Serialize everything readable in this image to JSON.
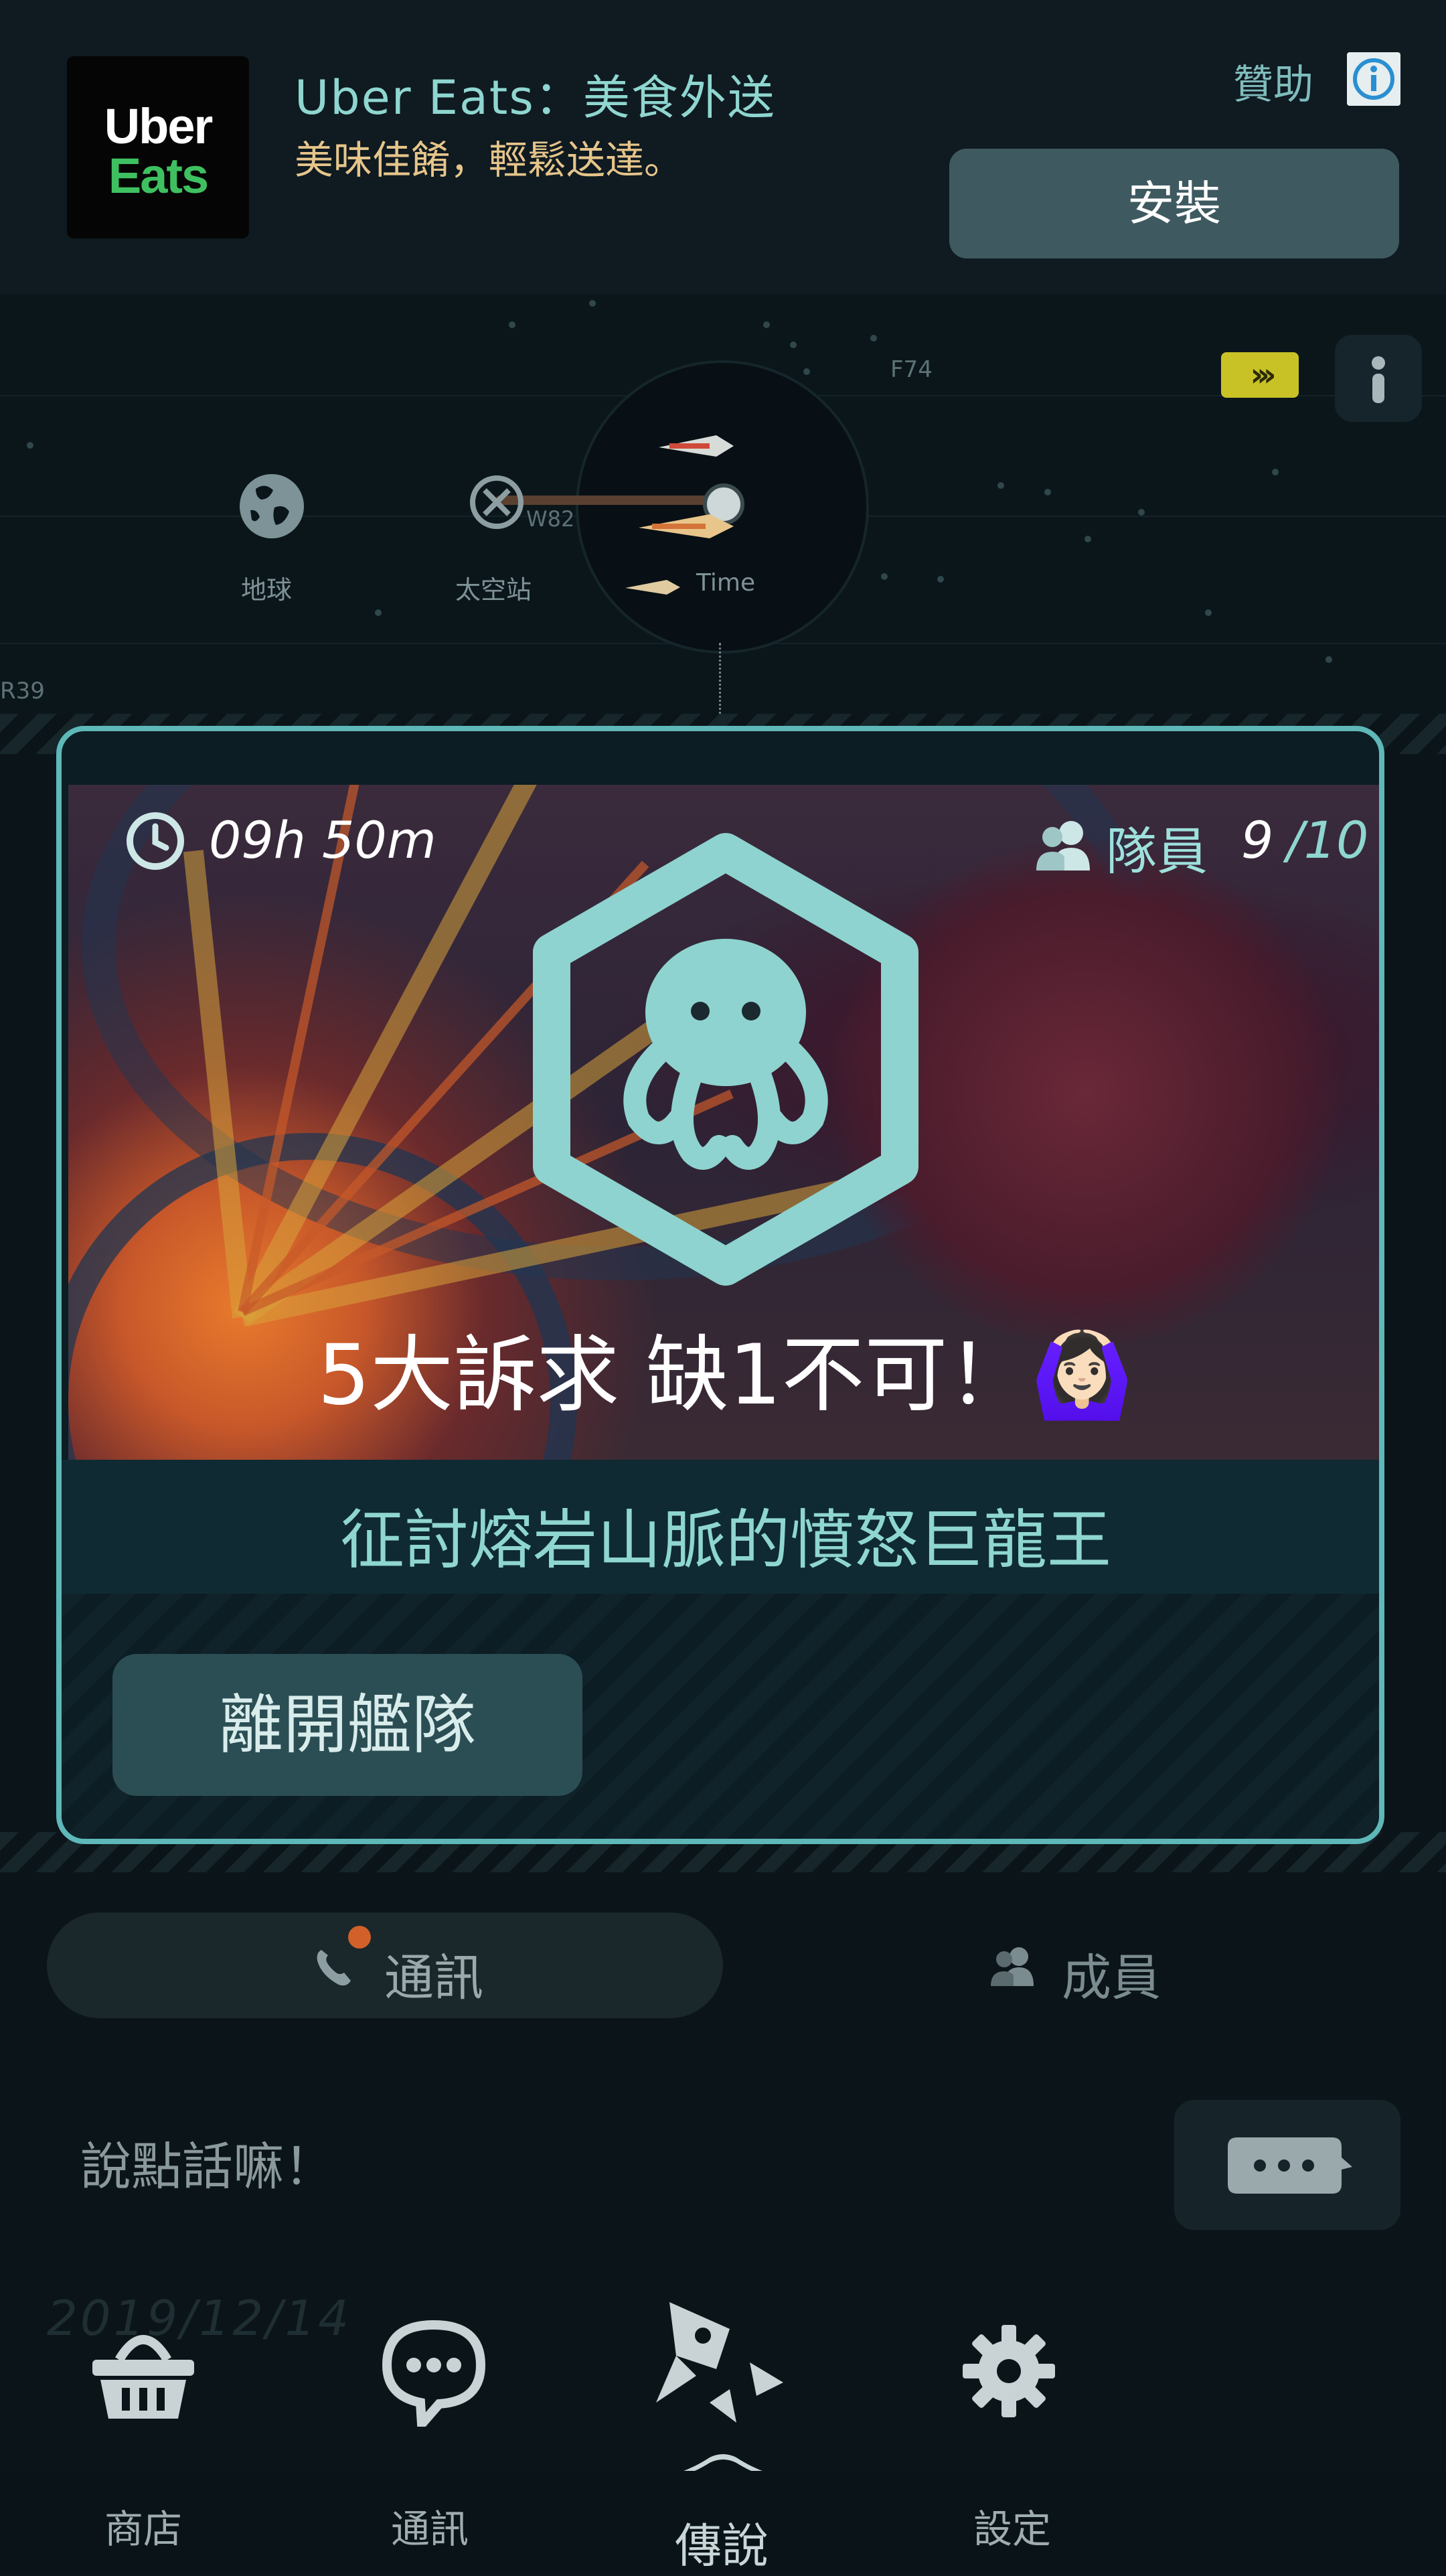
{
  "ad": {
    "logo_line1": "Uber",
    "logo_line2": "Eats",
    "title": "Uber Eats：美食外送",
    "subtitle": "美味佳餚，輕鬆送達。",
    "sponsor_label": "贊助",
    "install_label": "安裝"
  },
  "map": {
    "earth_label": "地球",
    "station_label": "太空站",
    "time_label": "Time",
    "marker_w82": "W82",
    "marker_f74": "F74",
    "marker_r39": "R39",
    "arrow_label": "›››"
  },
  "fleet": {
    "time_remaining": "09h 50m",
    "members_label": "隊員",
    "members_count": "9",
    "members_max": "/10",
    "slogan": "5大訴求 缺1不可！🙆🏻‍♀️",
    "title": "征討熔岩山脈的憤怒巨龍王",
    "leave_label": "離開艦隊",
    "badge_icon": "octopus-icon"
  },
  "tabs": {
    "comm_label": "通訊",
    "members_label": "成員"
  },
  "chat": {
    "placeholder": "說點話嘛！",
    "date": "2019/12/14"
  },
  "nav": {
    "store": "商店",
    "chat": "通訊",
    "legend": "傳說",
    "settings": "設定"
  },
  "colors": {
    "accent": "#5eb8b8",
    "background": "#0b1419",
    "notification_dot": "#d2602a",
    "ad_brand_green": "#3fc060"
  }
}
